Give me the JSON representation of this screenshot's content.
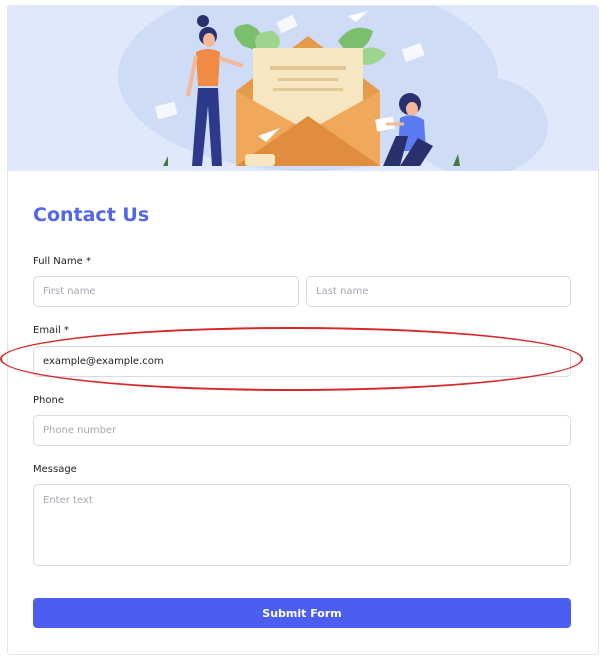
{
  "form": {
    "title": "Contact Us",
    "full_name_label": "Full Name *",
    "first_name_placeholder": "First name",
    "last_name_placeholder": "Last name",
    "email_label": "Email *",
    "email_value": "example@example.com",
    "phone_label": "Phone",
    "phone_placeholder": "Phone number",
    "message_label": "Message",
    "message_placeholder": "Enter text",
    "submit_label": "Submit Form"
  },
  "colors": {
    "accent": "#4c5ef0",
    "title": "#5465e6",
    "hero_background": "#dfe9fb",
    "annotation": "#d62a2a"
  },
  "icons": [
    "envelope-illustration",
    "woman-standing-illustration",
    "woman-sitting-illustration",
    "paper-plane-icon"
  ]
}
